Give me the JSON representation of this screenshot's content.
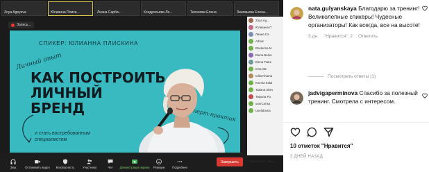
{
  "zoom": {
    "tiles": [
      {
        "name": "Zoya Ageyeva"
      },
      {
        "name": "Юлианна Плиск..."
      },
      {
        "name": "Лиана Сарби..."
      },
      {
        "name": "Кондратьева Ле..."
      },
      {
        "name": "Тихонова Елена"
      },
      {
        "name": "Зиновьева Елена..."
      }
    ],
    "recording_label": "Запись...",
    "slide": {
      "speaker_line": "СПИКЕР: ЮЛИАННА ПЛИСКИНА",
      "handwritten_1": "Личный опыт",
      "title_line1": "КАК ПОСТРОИТЬ",
      "title_line2": "ЛИЧНЫЙ",
      "title_line3": "БРЕНД",
      "subtitle": "и стать востребованным специалистом",
      "handwritten_2": "эксперт-практик"
    },
    "participants": [
      {
        "name": "Zoya Ag...",
        "color": "#9a6b4f"
      },
      {
        "name": "Юлианна П",
        "color": "#c26a8a"
      },
      {
        "name": "Лиана Са",
        "color": "#7a8fb0"
      },
      {
        "name": "Admin",
        "color": "#6fb04a"
      },
      {
        "name": "Ekaterina M",
        "color": "#6fb04a"
      },
      {
        "name": "Elena Belon",
        "color": "#8a6bb0"
      },
      {
        "name": "Elena Tsare",
        "color": "#6a9a9a"
      },
      {
        "name": "Irina SB",
        "color": "#6fb04a"
      },
      {
        "name": "Iullia Khama",
        "color": "#b08a5a"
      },
      {
        "name": "Ksenia Kalal",
        "color": "#6fb04a"
      },
      {
        "name": "Tatiana Shev",
        "color": "#6fb04a"
      },
      {
        "name": "Tatyana Po",
        "color": "#c05050"
      },
      {
        "name": "userConsp",
        "color": "#6fb04a"
      },
      {
        "name": "Uselidovna",
        "color": "#6fb04a"
      }
    ],
    "panel_footer": {
      "invite": "Пригласить",
      "mute": "Вык..."
    },
    "toolbar": [
      {
        "label": "Звук",
        "icon": "headphones-icon"
      },
      {
        "label": "Остановить видео",
        "icon": "video-camera-icon"
      },
      {
        "label": "Безопасность",
        "icon": "shield-icon"
      },
      {
        "label": "Участники",
        "icon": "participants-icon",
        "count": "41"
      },
      {
        "label": "Чат",
        "icon": "chat-icon"
      },
      {
        "label": "Демонстрация экрана",
        "icon": "share-screen-icon"
      },
      {
        "label": "Реакции",
        "icon": "smile-icon"
      },
      {
        "label": "Подробнее",
        "icon": "more-icon"
      }
    ],
    "end_button": "Завершить"
  },
  "instagram": {
    "comment1": {
      "user": "nata.gulyanskaya",
      "text": "Благодарю за тренинг! Великолепные спикеры! Чудесные организаторы! Как всегда, все на высоте!",
      "time": "3 дн.",
      "likes": "\"Нравится\": 2",
      "reply": "Ответить"
    },
    "view_replies": "Посмотреть ответы (1)",
    "comment2": {
      "user": "jadvigaperminova",
      "text": "Спасибо за полезный тренинг. Смотрела с интересом."
    },
    "likes_count": "10 отметок \"Нравится\"",
    "posted_ago": "3 ДНЕЙ НАЗАД"
  },
  "colors": {
    "slide_bg": "#39b9c0",
    "end_button": "#d93933",
    "zoom_bg": "#1b1b1b",
    "active_speaker": "#d8c94a"
  }
}
